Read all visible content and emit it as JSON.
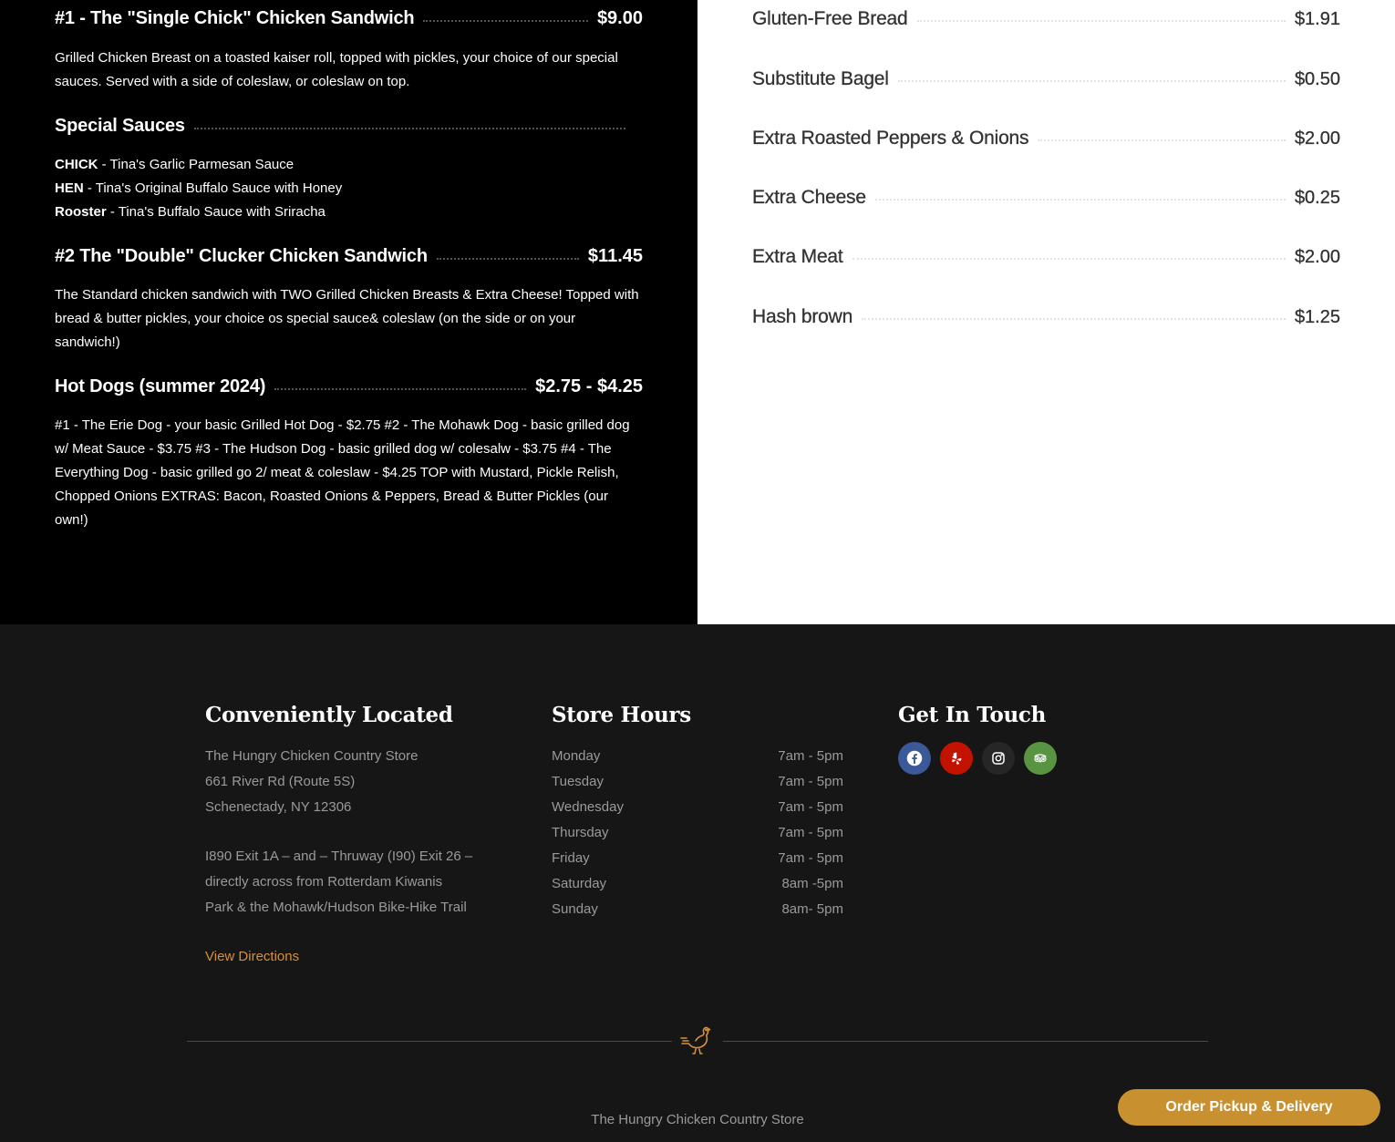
{
  "menu_left": {
    "item1": {
      "name": "#1 - The \"Single Chick\" Chicken Sandwich",
      "price": "$9.00",
      "description": "Grilled Chicken Breast on a toasted kaiser roll, topped with pickles, your choice of our special sauces. Served with a side of coleslaw, or coleslaw on top."
    },
    "special_sauces": {
      "title": "Special Sauces",
      "sauces": [
        {
          "name": "CHICK",
          "desc": " - Tina's Garlic Parmesan Sauce"
        },
        {
          "name": "HEN",
          "desc": " - Tina's Original Buffalo Sauce with Honey"
        },
        {
          "name": "Rooster",
          "desc": " - Tina's Buffalo Sauce with Sriracha"
        }
      ]
    },
    "item2": {
      "name": "#2 The \"Double\" Clucker Chicken Sandwich",
      "price": "$11.45",
      "description": "The Standard chicken sandwich with TWO Grilled Chicken Breasts & Extra Cheese! Topped with bread & butter pickles, your choice os special sauce& coleslaw (on the side or on your sandwich!)"
    },
    "item3": {
      "name": "Hot Dogs (summer 2024)",
      "price": "$2.75 - $4.25",
      "description": "#1 - The Erie Dog - your basic Grilled Hot Dog - $2.75 #2 - The Mohawk Dog - basic grilled dog w/ Meat Sauce - $3.75 #3 - The Hudson Dog - basic grilled dog w/ colesalw - $3.75 #4 - The Everything Dog - basic grilled go 2/ meat & coleslaw - $4.25 TOP with Mustard, Pickle Relish, Chopped Onions EXTRAS: Bacon, Roasted Onions & Peppers, Bread & Butter Pickles (our own!)"
    }
  },
  "menu_right": {
    "extras": [
      {
        "name": "Gluten-Free Bread",
        "price": "$1.91"
      },
      {
        "name": "Substitute Bagel",
        "price": "$0.50"
      },
      {
        "name": "Extra Roasted Peppers & Onions",
        "price": "$2.00"
      },
      {
        "name": "Extra Cheese",
        "price": "$0.25"
      },
      {
        "name": "Extra Meat",
        "price": "$2.00"
      },
      {
        "name": "Hash brown",
        "price": "$1.25"
      }
    ]
  },
  "footer": {
    "location": {
      "title": "Conveniently Located",
      "store_name": "The Hungry Chicken Country Store",
      "street": "661 River Rd (Route 5S)",
      "city": "Schenectady, NY 12306",
      "directions_line1": "I890 Exit 1A – and – Thruway (I90) Exit 26 –",
      "directions_line2": "directly across from Rotterdam Kiwanis",
      "directions_line3": "Park & the Mohawk/Hudson Bike-Hike Trail",
      "view_directions": "View Directions"
    },
    "hours": {
      "title": "Store Hours",
      "days": [
        {
          "day": "Monday",
          "time": "7am - 5pm"
        },
        {
          "day": "Tuesday",
          "time": "7am - 5pm"
        },
        {
          "day": "Wednesday",
          "time": "7am - 5pm"
        },
        {
          "day": "Thursday",
          "time": "7am - 5pm"
        },
        {
          "day": "Friday",
          "time": "7am - 5pm"
        },
        {
          "day": "Saturday",
          "time": "8am -5pm"
        },
        {
          "day": "Sunday",
          "time": "8am- 5pm"
        }
      ]
    },
    "contact": {
      "title": "Get In Touch",
      "social": [
        {
          "icon": "facebook-icon",
          "color": "#3b5998"
        },
        {
          "icon": "yelp-icon",
          "color": "#c41200"
        },
        {
          "icon": "instagram-icon",
          "color": "#262626"
        },
        {
          "icon": "tripadvisor-icon",
          "color": "#589442"
        }
      ]
    },
    "bottom_store_name": "The Hungry Chicken Country Store"
  },
  "order_button": "Order Pickup & Delivery",
  "colors": {
    "accent": "#d5913c",
    "order_button": "#c8902f",
    "footer_bg": "#161616"
  }
}
